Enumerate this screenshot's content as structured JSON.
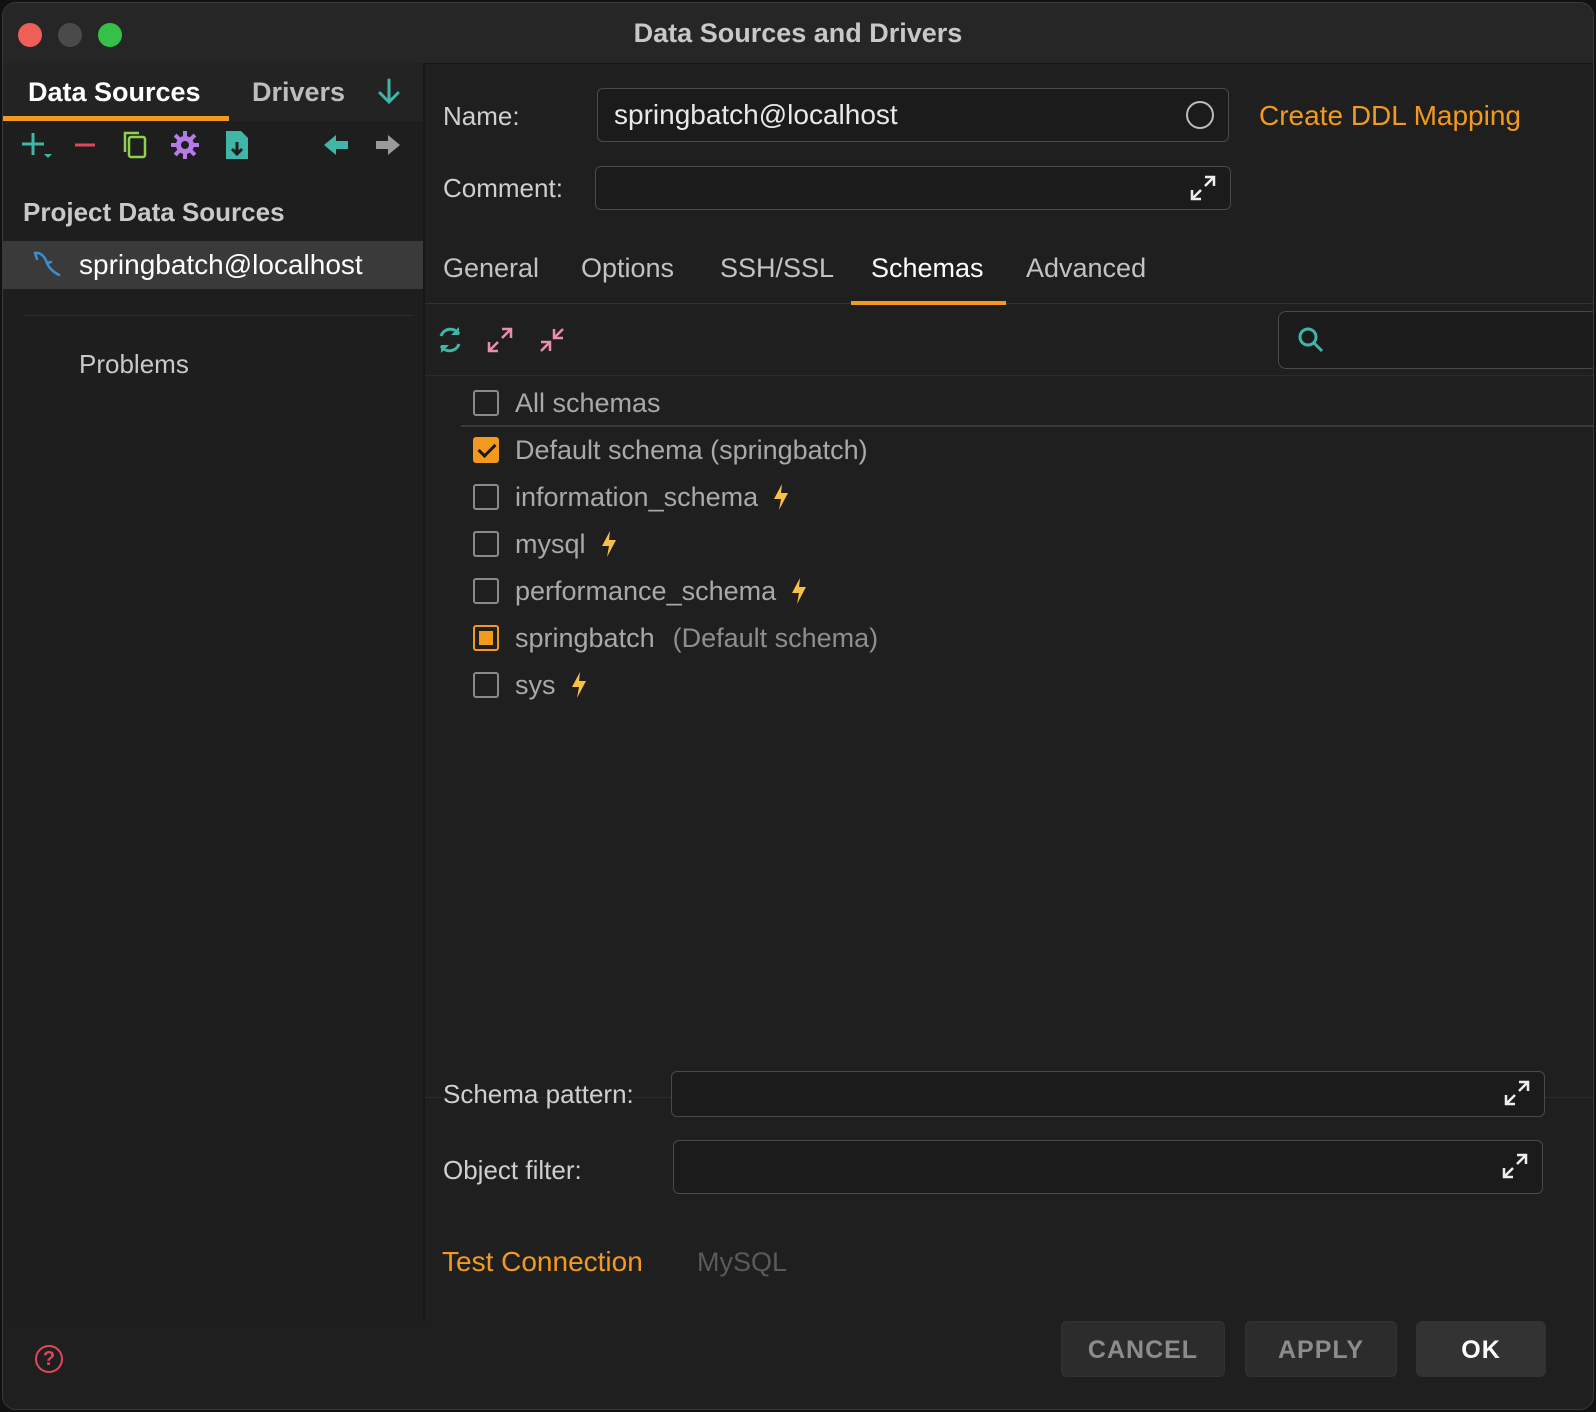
{
  "window": {
    "title": "Data Sources and Drivers"
  },
  "left": {
    "tabs": [
      {
        "label": "Data Sources"
      },
      {
        "label": "Drivers"
      }
    ],
    "section_title": "Project Data Sources",
    "items": [
      {
        "label": "springbatch@localhost"
      }
    ],
    "problems_label": "Problems",
    "icons": [
      "add-icon",
      "remove-icon",
      "copy-icon",
      "settings-icon",
      "import-icon",
      "back-icon",
      "forward-icon",
      "download-icon"
    ]
  },
  "form": {
    "name_label": "Name:",
    "name_value": "springbatch@localhost",
    "comment_label": "Comment:",
    "comment_value": "",
    "create_ddl_link": "Create DDL Mapping"
  },
  "tabs": [
    {
      "label": "General"
    },
    {
      "label": "Options"
    },
    {
      "label": "SSH/SSL"
    },
    {
      "label": "Schemas",
      "active": true
    },
    {
      "label": "Advanced"
    }
  ],
  "search": {
    "placeholder": ""
  },
  "schemas": [
    {
      "label": "All schemas",
      "sub": "",
      "state": "unchecked",
      "bolt": false
    },
    {
      "label": "Default schema (springbatch)",
      "sub": "",
      "state": "checked",
      "bolt": false
    },
    {
      "label": "information_schema",
      "sub": "",
      "state": "unchecked",
      "bolt": true
    },
    {
      "label": "mysql",
      "sub": "",
      "state": "unchecked",
      "bolt": true
    },
    {
      "label": "performance_schema",
      "sub": "",
      "state": "unchecked",
      "bolt": true
    },
    {
      "label": "springbatch",
      "sub": "(Default schema)",
      "state": "partial",
      "bolt": false
    },
    {
      "label": "sys",
      "sub": "",
      "state": "unchecked",
      "bolt": true
    }
  ],
  "filters": {
    "schema_pattern_label": "Schema pattern:",
    "schema_pattern_value": "",
    "object_filter_label": "Object filter:",
    "object_filter_value": ""
  },
  "test_connection_link": "Test Connection",
  "driver_label": "MySQL",
  "buttons": {
    "cancel": "CANCEL",
    "apply": "APPLY",
    "ok": "OK"
  },
  "colors": {
    "accent": "#f39a1e",
    "bolt": "#f7c04a",
    "teal": "#3fb6a8",
    "pink": "#e88fb0"
  }
}
